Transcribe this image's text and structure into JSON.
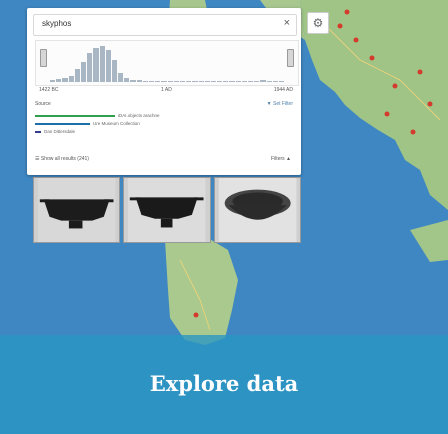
{
  "app": {
    "search": {
      "query": "skyphos",
      "close_symbol": "×"
    },
    "settings_symbol": "⚙"
  },
  "timeline": {
    "start_label": "1422 BC",
    "mid_label": "1 AD",
    "end_label": "1944 AD",
    "histogram_levels": [
      0.05,
      0.08,
      0.12,
      0.18,
      0.35,
      0.55,
      0.8,
      0.95,
      1,
      0.9,
      0.6,
      0.25,
      0.12,
      0.06,
      0.05,
      0.04,
      0.03,
      0.03,
      0.02,
      0.02,
      0.02,
      0.01,
      0.02,
      0.02,
      0.03,
      0.02,
      0.02,
      0.01,
      0.01,
      0.01,
      0.02,
      0.02,
      0.03,
      0.04,
      0.05,
      0.03,
      0.02,
      0.02
    ]
  },
  "source": {
    "title": "Source",
    "set_filter": "Set Filter",
    "items": [
      {
        "label": "iDAI.objects arachne",
        "color": "#2f9e4d",
        "level": 0.8
      },
      {
        "label": "Ure Museum Collection",
        "color": "#1e6fa8",
        "level": 0.55
      },
      {
        "label": "Dan Dittersdale",
        "color": "#333b8c",
        "level": 0.08
      }
    ]
  },
  "results": {
    "show_all": "Show all results (241)",
    "filters": "Filters"
  },
  "banner": {
    "title": "Explore data"
  },
  "colors": {
    "sea": "#3f87c2",
    "land": "#a9c98f",
    "banner": "#2a96c3"
  }
}
